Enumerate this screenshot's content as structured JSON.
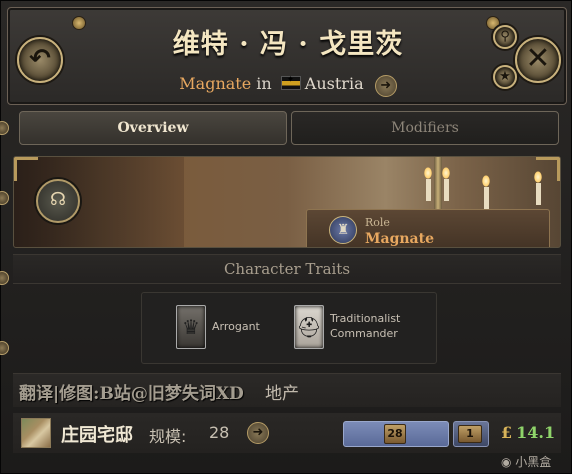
{
  "header": {
    "character_name": "维特 · 冯 · 戈里茨",
    "role": "Magnate",
    "in_word": "in",
    "country": "Austria"
  },
  "tabs": [
    {
      "label": "Overview",
      "active": true
    },
    {
      "label": "Modifiers",
      "active": false
    }
  ],
  "portrait": {
    "role_label": "Role",
    "role_value": "Magnate"
  },
  "traits": {
    "heading": "Character Traits",
    "items": [
      {
        "name": "Arrogant",
        "icon": "crown-icon"
      },
      {
        "name": "Traditionalist Commander",
        "icon": "helmet-icon"
      }
    ]
  },
  "watermark": "翻译|修图:B站@旧梦失词XD",
  "estates_heading": "地产",
  "estate": {
    "name": "庄园宅邸",
    "level_label": "规模:",
    "level": "28",
    "employment": "28",
    "buildings": "1",
    "currency_symbol": "£",
    "income": "14.1"
  },
  "logo_text": "小黑盒",
  "colors": {
    "role_text": "#e8a860",
    "income_text": "#8fd46a",
    "gold_accent": "#c8b17c"
  }
}
